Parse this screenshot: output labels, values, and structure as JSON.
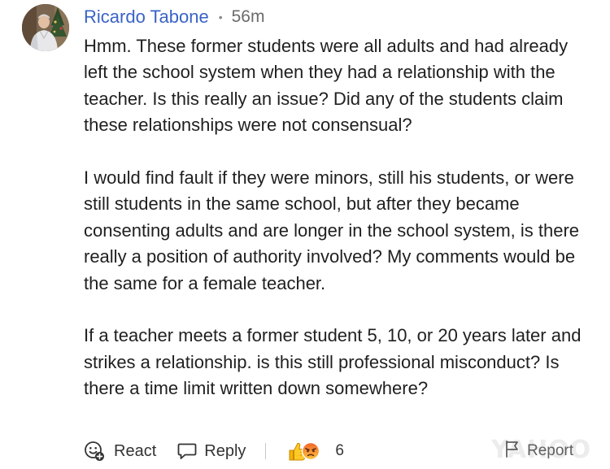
{
  "comment": {
    "author": "Ricardo Tabone",
    "separator": "•",
    "time": "56m",
    "paragraphs": [
      "Hmm. These former students were all adults and had already left the school system when they had a relationship with the teacher. Is this really an issue? Did any of the students claim these relationships were not consensual?",
      "I would find fault if they were minors, still his students, or were still students in the same school, but after they became consenting adults and are longer in the school system, is there really a position of authority involved? My comments would be the same for a female teacher.",
      "If a teacher meets a former student 5, 10, or 20 years later and strikes a relationship. is this still professional misconduct? Is there a time limit written down somewhere?"
    ]
  },
  "actions": {
    "react_label": "React",
    "reply_label": "Reply",
    "reaction_count": "6",
    "reaction_icons": [
      "thumbs-up-emoji",
      "angry-face-emoji"
    ],
    "report_label": "Report"
  },
  "watermark": "YAHOO",
  "colors": {
    "author": "#3a63c7",
    "text": "#1f1f1f",
    "muted": "#6b6b6b"
  }
}
